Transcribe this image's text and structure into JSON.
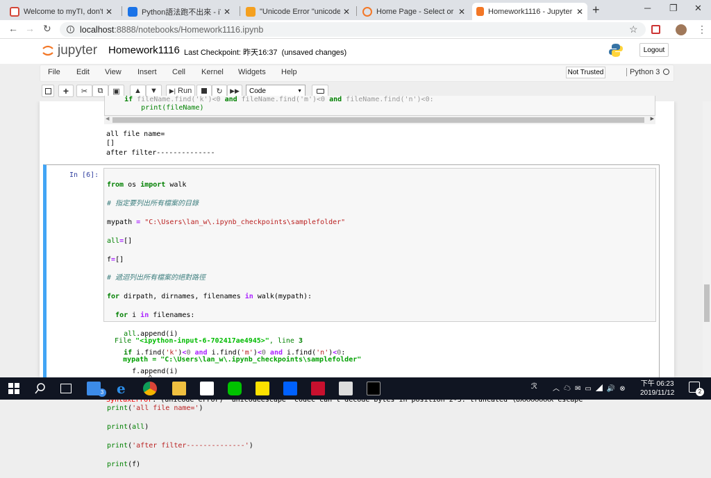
{
  "browser": {
    "tabs": [
      {
        "label": "Welcome to myTI, don't fo",
        "icon_color": "#d44638"
      },
      {
        "label": "Python語法跑不出來 - iT 邦",
        "icon_color": "#1a73e8"
      },
      {
        "label": "\"Unicode Error \"unicodees",
        "icon_color": "#f4a020"
      },
      {
        "label": "Home Page - Select or cre",
        "icon_color": "#f37726"
      },
      {
        "label": "Homework1116 - Jupyter",
        "icon_color": "#f37726"
      }
    ],
    "new_tab": "+",
    "url_prefix": "localhost",
    "url_rest": ":8888/notebooks/Homework1116.ipynb",
    "win_min": "─",
    "win_max": "❐",
    "win_close": "✕"
  },
  "jupyter": {
    "logo_text": "jupyter",
    "notebook_name": "Homework1116",
    "checkpoint": "Last Checkpoint: 昨天16:37",
    "unsaved": "(unsaved changes)",
    "logout": "Logout",
    "menu": [
      "File",
      "Edit",
      "View",
      "Insert",
      "Cell",
      "Kernel",
      "Widgets",
      "Help"
    ],
    "trusted": "Not Trusted",
    "kernel": "Python 3",
    "toolbar": {
      "run": "Run",
      "celltype": "Code"
    }
  },
  "prev_cell": {
    "code_line": "        print(fileName)",
    "output": [
      "all file name=",
      "[]",
      "after filter--------------"
    ]
  },
  "cell": {
    "prompt": "In [6]:",
    "code": [
      "from os import walk",
      "# 指定要列出所有檔案的目錄",
      "mypath = \"C:\\Users\\lan_w\\.ipynb_checkpoints\\samplefolder\"",
      "all=[]",
      "f=[]",
      "# 遞迴列出所有檔案的絕對路徑",
      "for dirpath, dirnames, filenames in walk(mypath):",
      "  for i in filenames:",
      "    all.append(i)",
      "    if i.find('k')<0 and i.find('m')<0 and i.find('n')<0:",
      "      f.append(i)",
      "",
      "print('all file name=')",
      "print(all)",
      "print('after filter--------------')",
      "print(f)"
    ],
    "error": {
      "file_line": "  File \"<ipython-input-6-702417ae4945>\", line 3",
      "path_line": "    mypath = \"C:\\Users\\lan_w\\.ipynb_checkpoints\\samplefolder\"",
      "caret": "          ^",
      "message": "SyntaxError: (unicode error) 'unicodeescape' codec can't decode bytes in position 2-3: truncated \\UXXXXXXXX escape"
    }
  },
  "taskbar": {
    "time": "下午 06:23",
    "date": "2019/11/12",
    "notif_count": "2",
    "badge_count": "3"
  }
}
